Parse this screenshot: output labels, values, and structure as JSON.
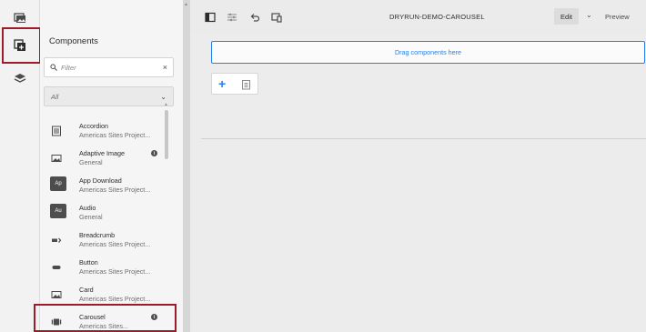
{
  "rail": {
    "items": [
      {
        "name": "assets-icon"
      },
      {
        "name": "components-icon",
        "selected": true
      },
      {
        "name": "content-tree-icon"
      }
    ],
    "highlight_color": "#9e1c2a"
  },
  "panel": {
    "title": "Components",
    "filter": {
      "placeholder": "Filter",
      "clear": "×"
    },
    "group_select": {
      "value": "All",
      "chevron": "⌄"
    },
    "components": [
      {
        "name": "Accordion",
        "group": "Americas Sites Project...",
        "icon": "accordion-icon"
      },
      {
        "name": "Adaptive Image",
        "group": "General",
        "icon": "image-icon",
        "info": "i"
      },
      {
        "name": "App Download",
        "group": "Americas Sites Project...",
        "badge": "Ap"
      },
      {
        "name": "Audio",
        "group": "General",
        "badge": "Au"
      },
      {
        "name": "Breadcrumb",
        "group": "Americas Sites Project...",
        "icon": "breadcrumb-icon"
      },
      {
        "name": "Button",
        "group": "Americas Sites Project...",
        "icon": "button-icon"
      },
      {
        "name": "Card",
        "group": "Americas Sites Project...",
        "icon": "card-icon"
      },
      {
        "name": "Carousel",
        "group": "Americas Sites...",
        "icon": "carousel-icon",
        "info": "i",
        "highlighted": true
      }
    ]
  },
  "toolbar": {
    "icons": [
      "toggle-side-panel-icon",
      "page-properties-icon",
      "undo-icon",
      "emulator-icon"
    ],
    "page_title": "DRYRUN-DEMO-CAROUSEL",
    "mode": "Edit",
    "mode_chevron": "⌄",
    "preview_label": "Preview"
  },
  "canvas": {
    "dropzone_label": "Drag components here",
    "accent": "#2680eb"
  }
}
